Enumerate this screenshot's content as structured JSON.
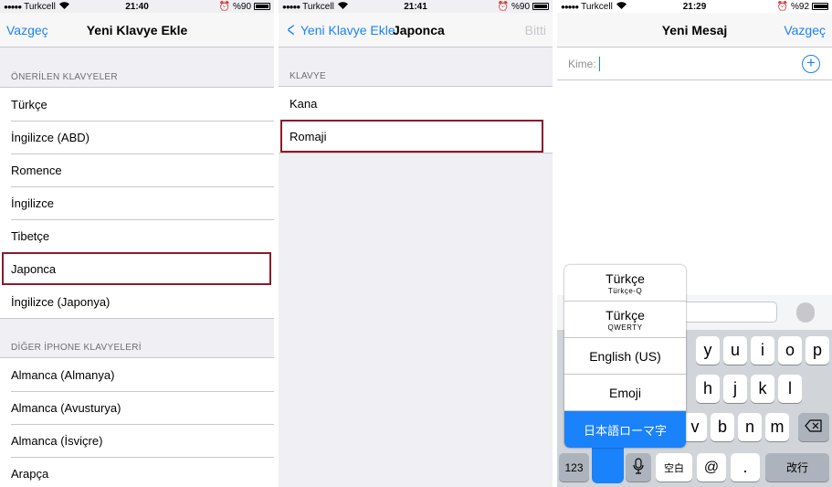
{
  "panels": {
    "left": {
      "status": {
        "dots": "●●●●●",
        "carrier": "Turkcell",
        "time": "21:40",
        "battery": "%90",
        "battery_level": 0.9
      },
      "nav": {
        "left": "Vazgeç",
        "title": "Yeni Klavye Ekle"
      },
      "sections": [
        {
          "header": "ÖNERİLEN KLAVYELER",
          "items": [
            "Türkçe",
            "İngilizce (ABD)",
            "Romence",
            "İngilizce",
            "Tibetçe",
            "Japonca",
            "İngilizce (Japonya)"
          ],
          "highlighted": "Japonca"
        },
        {
          "header": "DİĞER İPHONE KLAVYELERİ",
          "items": [
            "Almanca (Almanya)",
            "Almanca (Avusturya)",
            "Almanca (İsviçre)",
            "Arapça"
          ]
        }
      ]
    },
    "middle": {
      "status": {
        "dots": "●●●●●",
        "carrier": "Turkcell",
        "time": "21:41",
        "battery": "%90",
        "battery_level": 0.9
      },
      "nav": {
        "back": "Yeni Klavye Ekle",
        "title": "Japonca",
        "right": "Bitti"
      },
      "section": {
        "header": "KLAVYE",
        "items": [
          "Kana",
          "Romaji"
        ],
        "highlighted": "Romaji"
      }
    },
    "right": {
      "status": {
        "dots": "●●●●●",
        "carrier": "Turkcell",
        "time": "21:29",
        "battery": "%92",
        "battery_level": 0.92
      },
      "nav": {
        "title": "Yeni Mesaj",
        "right": "Vazgeç"
      },
      "to_label": "Kime:",
      "keyboard_menu": [
        {
          "label": "Türkçe",
          "sub": "Türkçe-Q"
        },
        {
          "label": "Türkçe",
          "sub": "QWERTY"
        },
        {
          "label": "English (US)",
          "sub": ""
        },
        {
          "label": "Emoji",
          "sub": ""
        },
        {
          "label": "日本語ローマ字",
          "sub": "",
          "selected": true
        }
      ],
      "keys": {
        "row1": [
          "y",
          "u",
          "i",
          "o",
          "p"
        ],
        "row2": [
          "h",
          "j",
          "k",
          "l"
        ],
        "row3": [
          "v",
          "b",
          "n",
          "m"
        ],
        "numbers": "123",
        "space": "空白",
        "at": "@",
        "dot": ".",
        "return": "改行"
      },
      "icons": [
        "add-contact-icon",
        "mic-icon",
        "backspace-icon"
      ]
    }
  },
  "colors": {
    "accent": "#1a82fb",
    "highlight": "#8b1a2b"
  }
}
